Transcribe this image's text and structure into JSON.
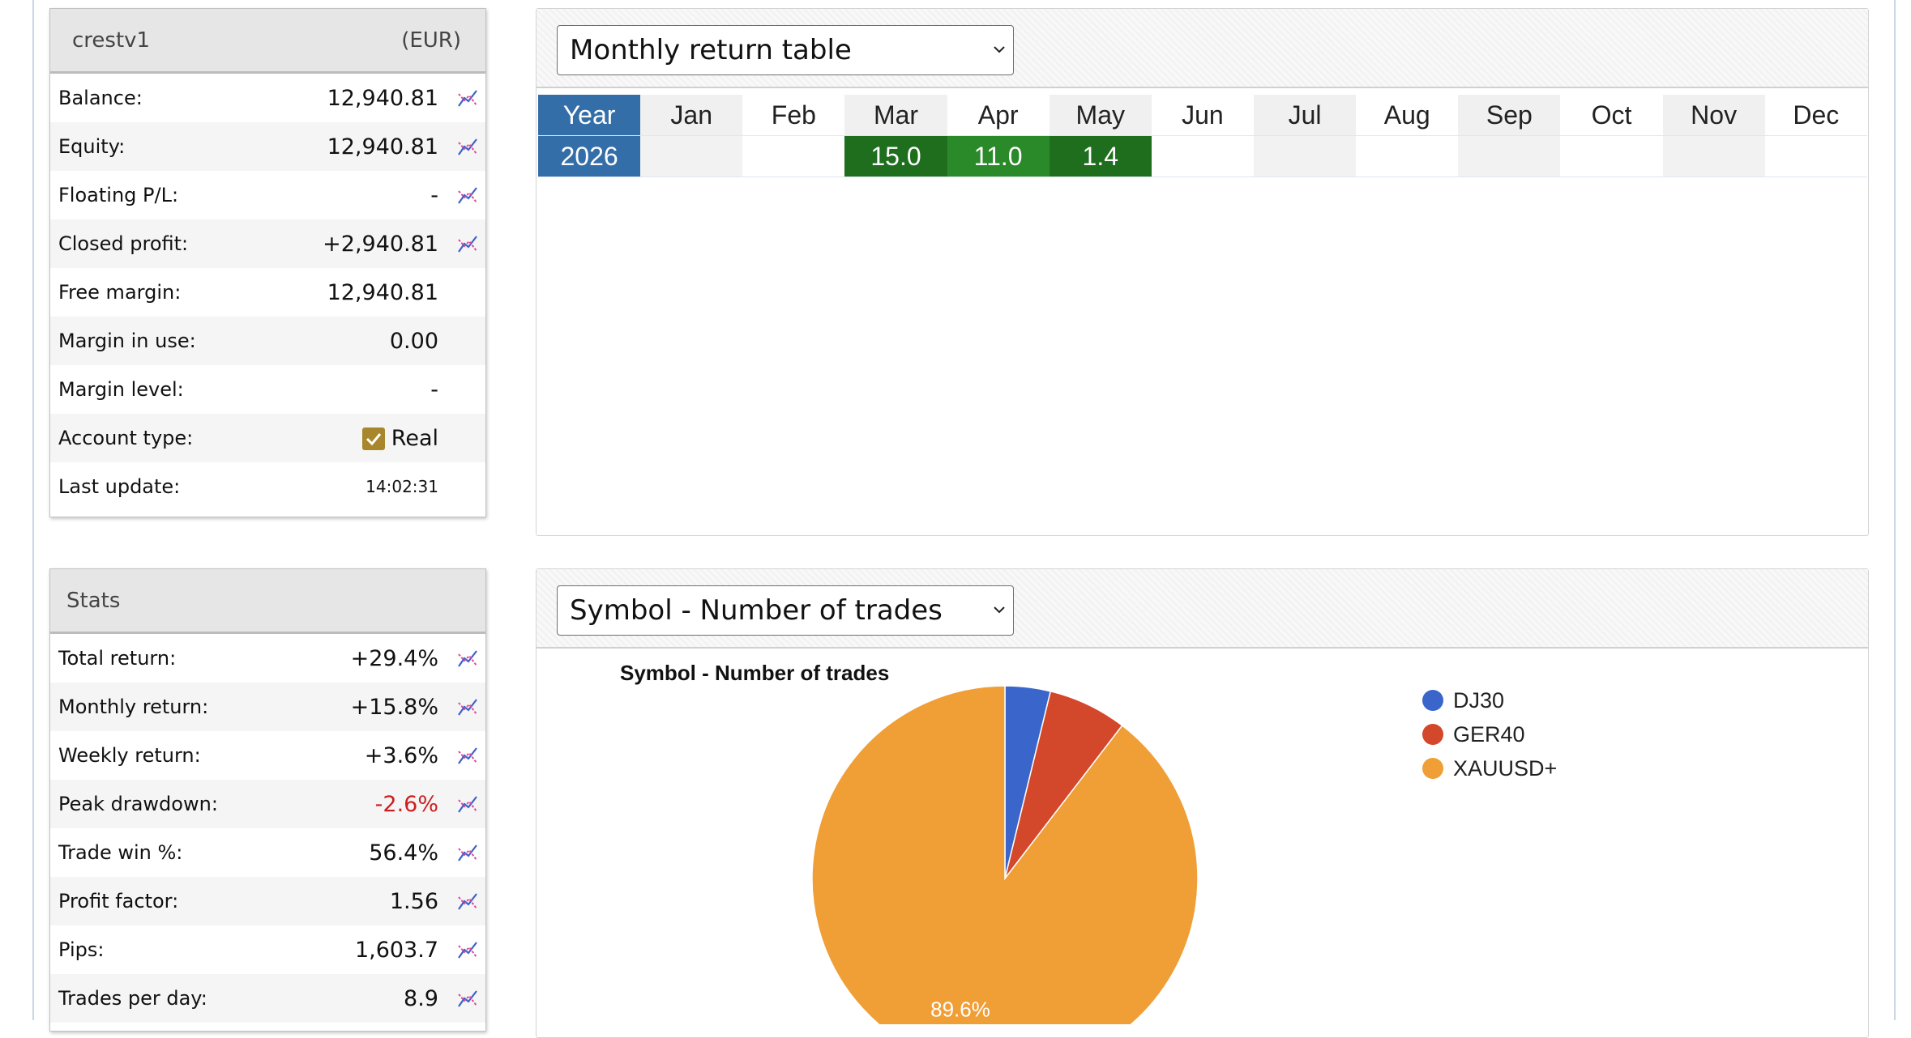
{
  "account": {
    "name": "crestv1",
    "currency": "(EUR)",
    "rows": [
      {
        "label": "Balance:",
        "value": "12,940.81",
        "chart": true
      },
      {
        "label": "Equity:",
        "value": "12,940.81",
        "chart": true
      },
      {
        "label": "Floating P/L:",
        "value": "-",
        "chart": true
      },
      {
        "label": "Closed profit:",
        "value": "+2,940.81",
        "chart": true
      },
      {
        "label": "Free margin:",
        "value": "12,940.81",
        "chart": false
      },
      {
        "label": "Margin in use:",
        "value": "0.00",
        "chart": false
      },
      {
        "label": "Margin level:",
        "value": "-",
        "chart": false
      },
      {
        "label": "Account type:",
        "value": "Real",
        "chart": false
      },
      {
        "label": "Last update:",
        "value": "14:02:31",
        "chart": false
      }
    ]
  },
  "stats": {
    "title": "Stats",
    "rows": [
      {
        "label": "Total return:",
        "value": "+29.4%"
      },
      {
        "label": "Monthly return:",
        "value": "+15.8%"
      },
      {
        "label": "Weekly return:",
        "value": "+3.6%"
      },
      {
        "label": "Peak drawdown:",
        "value": "-2.6%"
      },
      {
        "label": "Trade win %:",
        "value": "56.4%"
      },
      {
        "label": "Profit factor:",
        "value": "1.56"
      },
      {
        "label": "Pips:",
        "value": "1,603.7"
      },
      {
        "label": "Trades per day:",
        "value": "8.9"
      }
    ]
  },
  "monthly": {
    "select_value": "Monthly return table",
    "headers": [
      "Year",
      "Jan",
      "Feb",
      "Mar",
      "Apr",
      "May",
      "Jun",
      "Jul",
      "Aug",
      "Sep",
      "Oct",
      "Nov",
      "Dec"
    ],
    "row": [
      "2026",
      "",
      "",
      "15.0",
      "11.0",
      "1.4",
      "",
      "",
      "",
      "",
      "",
      "",
      ""
    ]
  },
  "symbol": {
    "select_value": "Symbol - Number of trades"
  },
  "chart_data": {
    "type": "pie",
    "title": "Symbol - Number of trades",
    "labels": [
      "DJ30",
      "GER40",
      "XAUUSD+"
    ],
    "values": [
      3.8,
      6.6,
      89.6
    ],
    "colors": [
      "#3a66cc",
      "#d3472a",
      "#f09e36"
    ],
    "data_labels": [
      "",
      "",
      "89.6%"
    ],
    "legend_position": "right"
  },
  "colors": {
    "year_bg": "#346ea8",
    "positive_green": "#2a8a2a",
    "negative_red": "#cc1f1f",
    "check_gold": "#a8862b"
  },
  "icons": {
    "row_chart": "line-chart-icon",
    "select_caret": "chevron-down-icon",
    "account_type": "checkbox-checked-icon"
  }
}
